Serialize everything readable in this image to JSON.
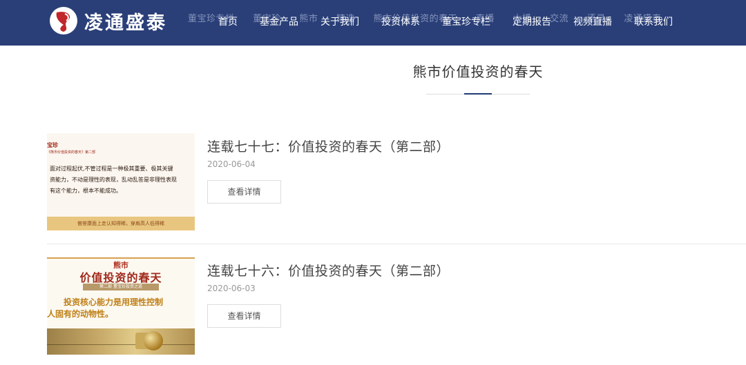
{
  "header": {
    "logo_text": "凌通盛泰",
    "ticker": [
      "董宝珍专栏",
      "董宝珍",
      "熊市",
      "精选",
      "熊市价值投资的春天",
      "直播",
      "大播",
      "交流",
      "语录",
      "凌通盛泰"
    ],
    "nav": [
      "首页",
      "基金产品",
      "关于我们",
      "投资体系",
      "董宝珍专栏",
      "定期报告",
      "视频直播",
      "联系我们"
    ]
  },
  "page": {
    "title": "熊市价值投资的春天"
  },
  "articles": [
    {
      "title": "连载七十七：价值投资的春天（第二部）",
      "date": "2020-06-04",
      "button": "查看详情",
      "thumb": {
        "head": "宝珍",
        "sub": "《熊市价值投资的春天》第二部",
        "body": "面对过程起伏,不管过程是一种极其重要、极其关键\n资能力，不动是理性的表现，乱动乱答是非理性表现\n有这个能力，根本不能成功。",
        "foot": "傲誉康面上走认知得稀，穿肩高人低得稀"
      }
    },
    {
      "title": "连载七十六：价值投资的春天（第二部）",
      "date": "2020-06-03",
      "button": "查看详情",
      "thumb": {
        "small": "熊市",
        "big": "价值投资的春天",
        "tag": "第二部 董宝珍投资之道",
        "line1": "投资核心能力是用理性控制",
        "line2": "人固有的动物性。"
      }
    }
  ]
}
